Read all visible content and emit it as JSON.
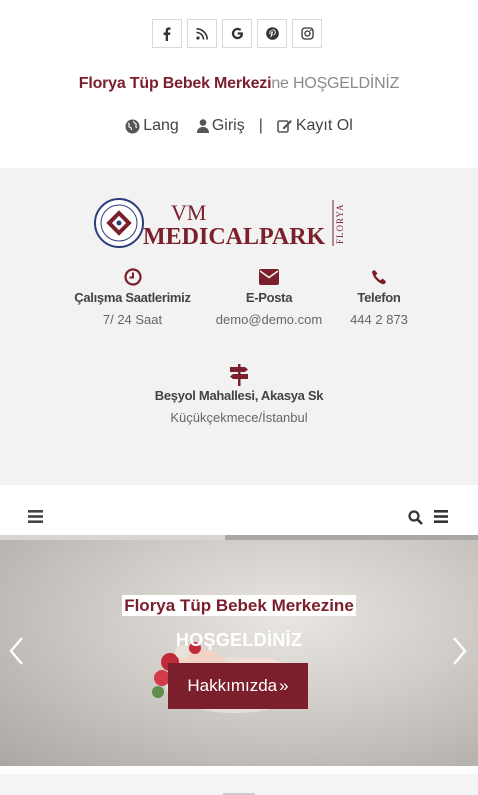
{
  "social": {
    "items": [
      "facebook-icon",
      "rss-icon",
      "google-icon",
      "pinterest-icon",
      "instagram-icon"
    ]
  },
  "welcome": {
    "brand": "Florya Tüp Bebek Merkezi",
    "rest": "ne HOŞGELDİNİZ"
  },
  "auth": {
    "lang": "Lang",
    "login": "Giriş",
    "separator": "|",
    "register": "Kayıt Ol"
  },
  "logo": {
    "text": "MEDICALPARK",
    "mark": "VM",
    "side": "FLORYA",
    "seal": "İSTANBUL AYDIN ÜNİVERSİTESİ HASTANESİ"
  },
  "info": {
    "hours": {
      "title": "Çalışma Saatlerimiz",
      "value": "7/ 24 Saat"
    },
    "email": {
      "title": "E-Posta",
      "value": "demo@demo.com"
    },
    "phone": {
      "title": "Telefon",
      "value": "444 2 873"
    },
    "address": {
      "title": "Beşyol Mahallesi, Akasya Sk",
      "value": "Küçükçekmece/İstanbul"
    }
  },
  "slider": {
    "title": "Florya Tüp Bebek Merkezine",
    "subtitle": "HOŞGELDİNİZ",
    "button": "Hakkımızda",
    "button_icon": "»",
    "progress": 0.47
  },
  "colors": {
    "brand": "#7a1f2b",
    "grey_band": "#f2f2f2"
  }
}
